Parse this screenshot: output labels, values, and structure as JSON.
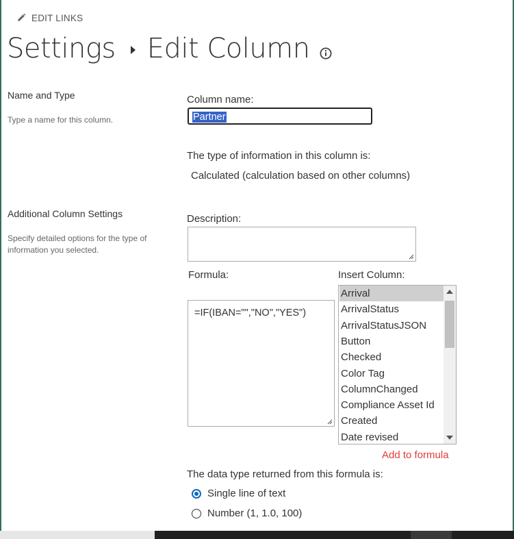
{
  "header": {
    "edit_links_label": "EDIT LINKS",
    "icon": "pencil-icon"
  },
  "title": {
    "parent": "Settings",
    "current": "Edit Column",
    "info_icon": "info-icon"
  },
  "name_and_type": {
    "heading": "Name and Type",
    "description": "Type a name for this column.",
    "column_name_label": "Column name:",
    "column_name_value": "Partner",
    "type_intro": "The type of information in this column is:",
    "type_value": "Calculated (calculation based on other columns)"
  },
  "additional_settings": {
    "heading": "Additional Column Settings",
    "description": "Specify detailed options for the type of information you selected.",
    "description_label": "Description:",
    "description_value": "",
    "formula_label": "Formula:",
    "formula_value": "=IF(IBAN=\"\",\"NO\",\"YES\")",
    "insert_column_label": "Insert Column:",
    "insert_columns": [
      "Arrival",
      "ArrivalStatus",
      "ArrivalStatusJSON",
      "Button",
      "Checked",
      "Color Tag",
      "ColumnChanged",
      "Compliance Asset Id",
      "Created",
      "Date revised"
    ],
    "selected_column": "Arrival",
    "add_to_formula": "Add to formula",
    "return_type_label": "The data type returned from this formula is:",
    "return_types": [
      {
        "label": "Single line of text",
        "checked": true
      },
      {
        "label": "Number (1, 1.0, 100)",
        "checked": false
      }
    ]
  },
  "colors": {
    "accent": "#0f6cbd",
    "link_red": "#e33b3b",
    "selection": "#3563c8",
    "frame": "#2f6f62"
  }
}
